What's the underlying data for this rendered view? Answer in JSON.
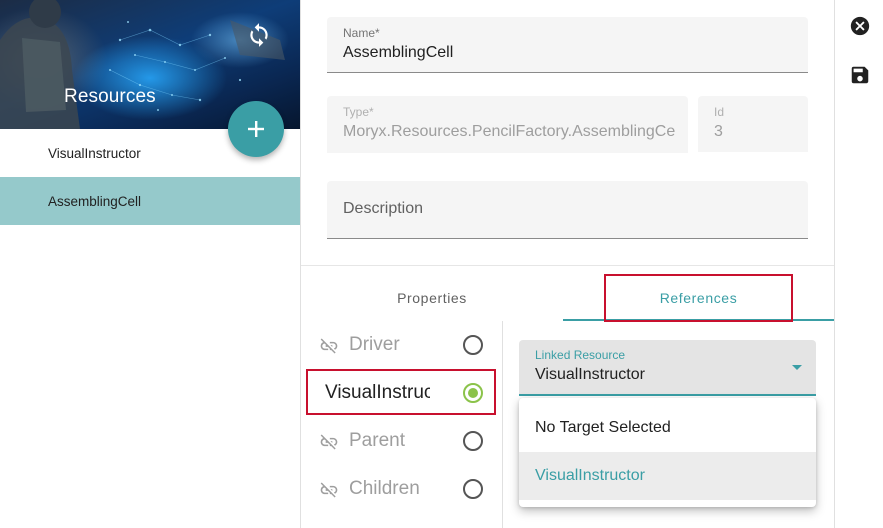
{
  "sidebar": {
    "title": "Resources",
    "items": [
      {
        "label": "VisualInstructor"
      },
      {
        "label": "AssemblingCell"
      }
    ]
  },
  "form": {
    "name": {
      "label": "Name*",
      "value": "AssemblingCell"
    },
    "type": {
      "label": "Type*",
      "value": "Moryx.Resources.PencilFactory.AssemblingCell"
    },
    "id": {
      "label": "Id",
      "value": "3"
    },
    "description": {
      "placeholder": "Description"
    }
  },
  "tabs": {
    "properties": "Properties",
    "references": "References"
  },
  "references": {
    "items": [
      {
        "label": "Driver",
        "selected": false,
        "linked": false
      },
      {
        "label": "VisualInstructor",
        "selected": true,
        "linked": true
      },
      {
        "label": "Parent",
        "selected": false,
        "linked": false
      },
      {
        "label": "Children",
        "selected": false,
        "linked": false
      }
    ],
    "linked_resource": {
      "label": "Linked Resource",
      "value": "VisualInstructor",
      "options": [
        "No Target Selected",
        "VisualInstructor"
      ]
    }
  },
  "icons": {
    "refresh": "refresh-icon",
    "add": "add-icon",
    "close": "close-circle-icon",
    "save": "save-icon",
    "unlink": "link-off-icon"
  },
  "colors": {
    "accent": "#3a9ea5",
    "selected_row": "#95c9cb",
    "radio_checked": "#8bc34a",
    "highlight_box": "#c8102e"
  }
}
